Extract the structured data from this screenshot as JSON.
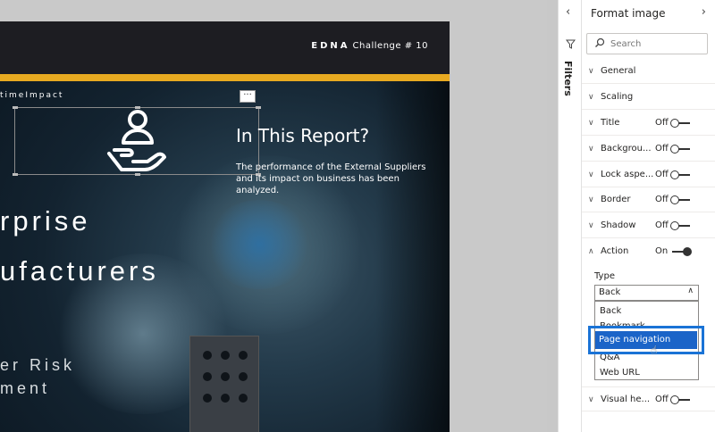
{
  "report": {
    "brand_bold": "EDNA",
    "brand_rest": "Challenge # 10",
    "hashtag": "timeImpact",
    "title": "In This Report?",
    "description": "The performance of the External Suppliers and its impact on business has been analyzed.",
    "big_line1": "rprise",
    "big_line2": "ufacturers",
    "big_line3": "er Risk",
    "big_line4": "ment",
    "more_glyph": "···"
  },
  "colors": {
    "accent_stripe": "#e8aa21",
    "selection_blue": "#1b64c8",
    "highlight_border": "#1a73d6"
  },
  "filters": {
    "label": "Filters"
  },
  "pane": {
    "title": "Format image",
    "search_placeholder": "Search",
    "sections": [
      {
        "label": "General",
        "state": ""
      },
      {
        "label": "Scaling",
        "state": ""
      },
      {
        "label": "Title",
        "state": "Off"
      },
      {
        "label": "Backgrou...",
        "state": "Off"
      },
      {
        "label": "Lock aspe...",
        "state": "Off"
      },
      {
        "label": "Border",
        "state": "Off"
      },
      {
        "label": "Shadow",
        "state": "Off"
      },
      {
        "label": "Action",
        "state": "On"
      }
    ],
    "type_label": "Type",
    "type_value": "Back",
    "options": [
      "Back",
      "Bookmark",
      "Page navigation",
      "Q&A",
      "Web URL"
    ],
    "last_section": {
      "label": "Visual he...",
      "state": "Off"
    }
  }
}
